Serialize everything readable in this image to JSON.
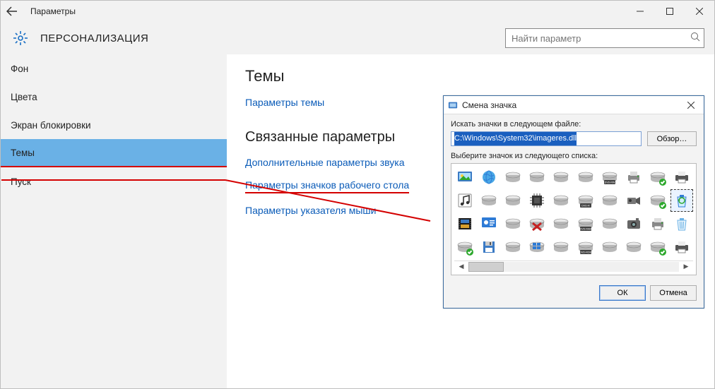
{
  "window": {
    "title": "Параметры",
    "section": "ПЕРСОНАЛИЗАЦИЯ"
  },
  "search": {
    "placeholder": "Найти параметр"
  },
  "sidebar": {
    "items": [
      {
        "label": "Фон"
      },
      {
        "label": "Цвета"
      },
      {
        "label": "Экран блокировки"
      },
      {
        "label": "Темы",
        "selected": true
      },
      {
        "label": "Пуск"
      }
    ]
  },
  "content": {
    "heading1": "Темы",
    "link_theme_settings": "Параметры темы",
    "heading2": "Связанные параметры",
    "link_sound": "Дополнительные параметры звука",
    "link_desktop_icons": "Параметры значков рабочего стола",
    "link_pointer": "Параметры указателя мыши"
  },
  "dialog": {
    "title": "Смена значка",
    "label_search": "Искать значки в следующем файле:",
    "path_value": "C:\\Windows\\System32\\imageres.dll",
    "browse": "Обзор…",
    "label_choose": "Выберите значок из следующего списка:",
    "btn_ok": "ОК",
    "btn_cancel": "Отмена",
    "icons": [
      [
        "photo",
        "globe",
        "disk",
        "disk",
        "disk",
        "disk",
        "dvd-rw",
        "printer",
        "disk-check",
        "printer2"
      ],
      [
        "music",
        "disk",
        "disk",
        "chip",
        "disk",
        "dvd-r",
        "disk",
        "camcorder",
        "disk-check",
        "recycle-sel"
      ],
      [
        "film",
        "settings",
        "disk",
        "disk-x",
        "disk",
        "dvd-ram",
        "disk",
        "camera",
        "printer",
        "recycle"
      ],
      [
        "disk-check",
        "floppy",
        "disk",
        "win-disk",
        "disk",
        "dvd-rom",
        "disk",
        "disk",
        "disk-check",
        "printer2"
      ]
    ]
  }
}
